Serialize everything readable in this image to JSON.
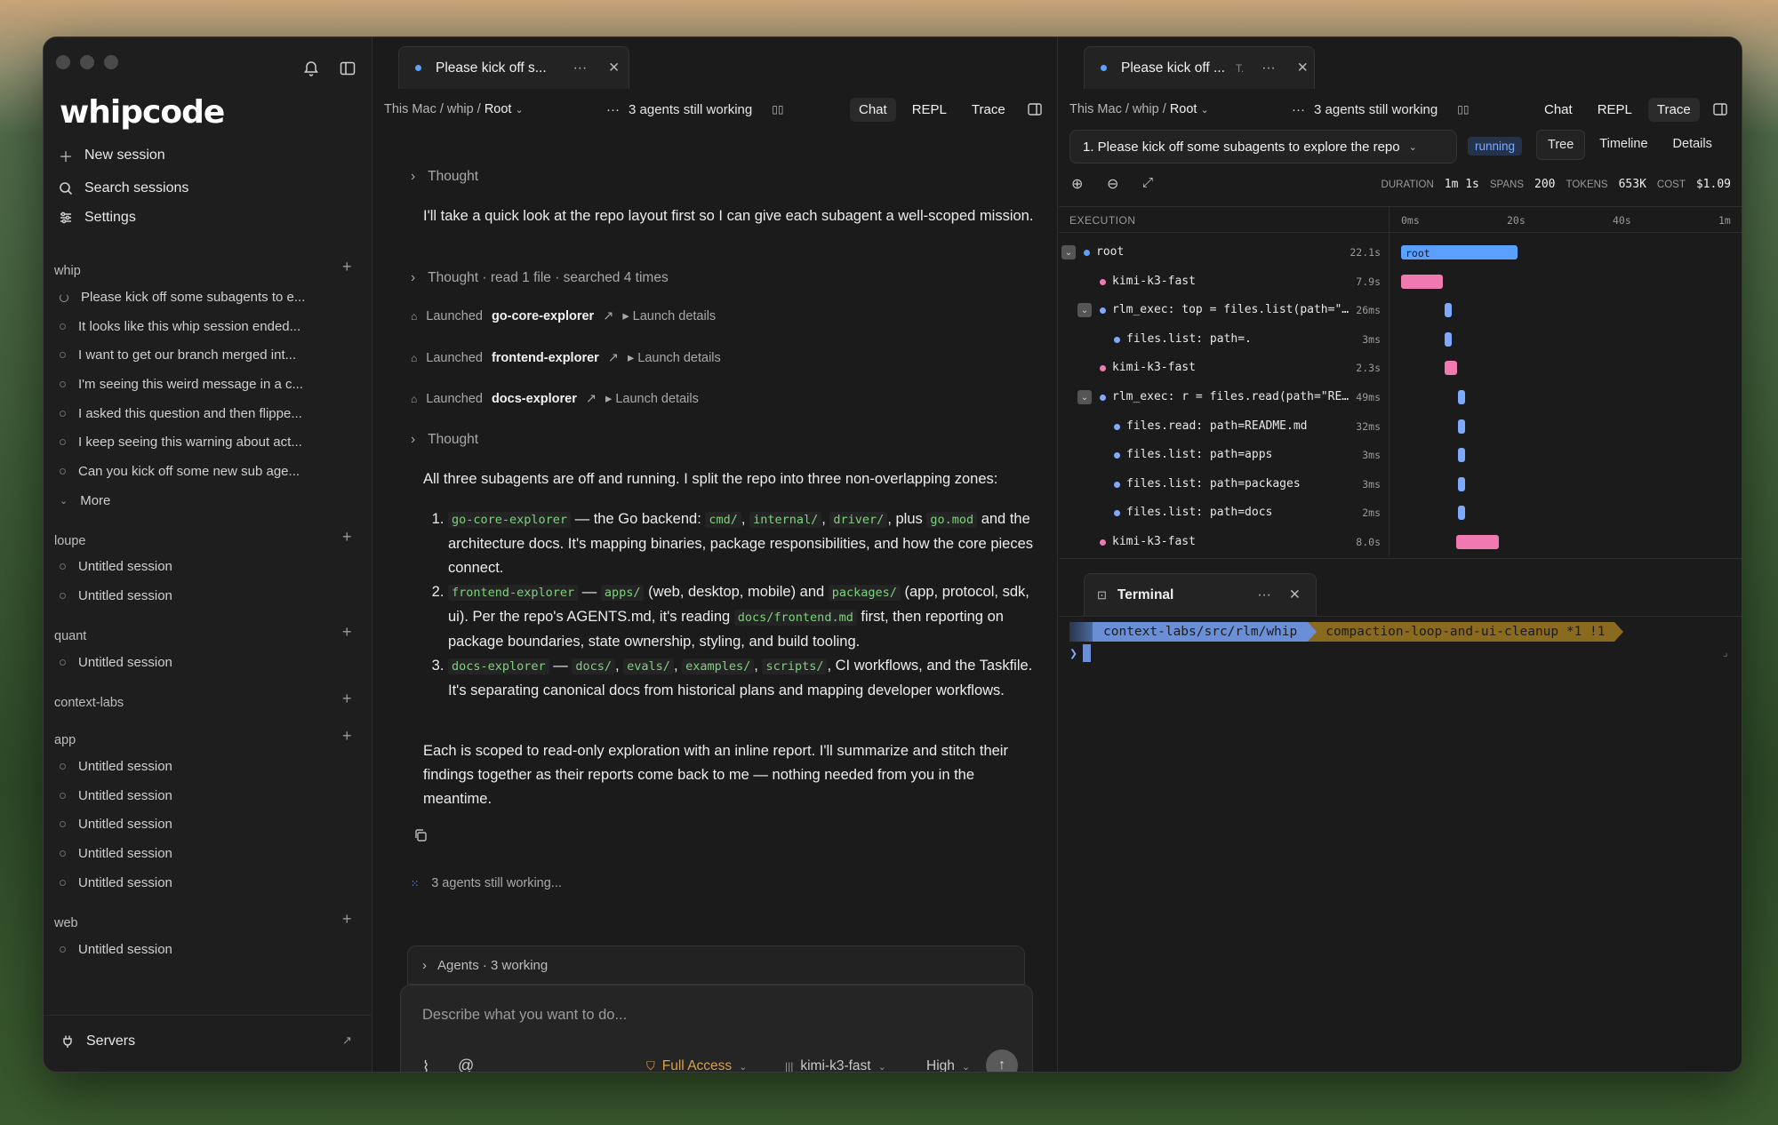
{
  "sidebar": {
    "logo": "whipcode",
    "nav": {
      "new_session": "New session",
      "search": "Search sessions",
      "settings": "Settings"
    },
    "groups": [
      {
        "name": "whip",
        "sessions": [
          "Please kick off some subagents to e...",
          "It looks like this whip session ended...",
          "I want to get our branch merged int...",
          "I'm seeing this weird message in a c...",
          "I asked this question and then flippe...",
          "I keep seeing this warning about act...",
          "Can you kick off some new sub age..."
        ],
        "more": "More"
      },
      {
        "name": "loupe",
        "sessions": [
          "Untitled session",
          "Untitled session"
        ]
      },
      {
        "name": "quant",
        "sessions": [
          "Untitled session"
        ]
      },
      {
        "name": "context-labs",
        "sessions": []
      },
      {
        "name": "app",
        "sessions": [
          "Untitled session",
          "Untitled session",
          "Untitled session",
          "Untitled session",
          "Untitled session"
        ]
      },
      {
        "name": "web",
        "sessions": [
          "Untitled session"
        ]
      }
    ],
    "servers": "Servers"
  },
  "chat": {
    "tab_title": "Please kick off s...",
    "breadcrumb_prefix": "This Mac / whip /",
    "breadcrumb_root": "Root",
    "agents_status": "3 agents still working",
    "modes": [
      "Chat",
      "REPL",
      "Trace"
    ],
    "thought1": "Thought",
    "msg1": "I'll take a quick look at the repo layout first so I can give each subagent a well-scoped mission.",
    "thought2": "Thought · read 1 file · searched 4 times",
    "launched_word": "Launched",
    "launch_details": "Launch details",
    "agents": [
      "go-core-explorer",
      "frontend-explorer",
      "docs-explorer"
    ],
    "thought3": "Thought",
    "msg2": "All three subagents are off and running. I split the repo into three non-overlapping zones:",
    "item1": {
      "name": "go-core-explorer",
      "t1": " — the Go backend: ",
      "c1": "cmd/",
      "c2": "internal/",
      "c3": "driver/",
      "t2": ", plus ",
      "c4": "go.mod",
      "t3": " and the architecture docs. It's mapping binaries, package responsibilities, and how the core pieces connect."
    },
    "item2": {
      "name": "frontend-explorer",
      "t1": " — ",
      "c1": "apps/",
      "t2": " (web, desktop, mobile) and ",
      "c2": "packages/",
      "t3": " (app, protocol, sdk, ui). Per the repo's AGENTS.md, it's reading ",
      "c3": "docs/frontend.md",
      "t4": " first, then reporting on package boundaries, state ownership, styling, and build tooling."
    },
    "item3": {
      "name": "docs-explorer",
      "t1": " — ",
      "c1": "docs/",
      "c2": "evals/",
      "c3": "examples/",
      "c4": "scripts/",
      "t2": ", CI workflows, and the Taskfile. It's separating canonical docs from historical plans and mapping developer workflows."
    },
    "msg3": "Each is scoped to read-only exploration with an inline report. I'll summarize and stitch their findings together as their reports come back to me — nothing needed from you in the meantime.",
    "working": "3 agents still working...",
    "agents_bar": "Agents · 3 working",
    "placeholder": "Describe what you want to do...",
    "access": "Full Access",
    "model": "kimi-k3-fast",
    "effort": "High"
  },
  "trace": {
    "tab_title": "Please kick off ...",
    "tab_suffix": "T.",
    "breadcrumb_prefix": "This Mac / whip /",
    "breadcrumb_root": "Root",
    "agents_status": "3 agents still working",
    "modes": [
      "Chat",
      "REPL",
      "Trace"
    ],
    "run_select": "1. Please kick off some subagents to explore the repo",
    "run_status": "running",
    "views": [
      "Tree",
      "Timeline",
      "Details"
    ],
    "stats": {
      "duration_label": "DURATION",
      "duration": "1m 1s",
      "spans_label": "SPANS",
      "spans": "200",
      "tokens_label": "TOKENS",
      "tokens": "653K",
      "cost_label": "COST",
      "cost": "$1.09"
    },
    "execution_label": "EXECUTION",
    "ticks": [
      "0ms",
      "20s",
      "40s",
      "1m"
    ],
    "spans": [
      {
        "name": "root",
        "duration": "22.1s",
        "color": "#5aa0ff",
        "bar_label": "root",
        "start_s": 0,
        "len_s": 22.1
      },
      {
        "name": "kimi-k3-fast",
        "duration": "7.9s",
        "color": "#f07ab0",
        "start_s": 0,
        "len_s": 7.9
      },
      {
        "name": "rlm_exec: top = files.list(path=\"…",
        "duration": "26ms",
        "color": "#7fa8ff",
        "start_s": 8.2,
        "len_s": 0.026
      },
      {
        "name": "files.list: path=.",
        "duration": "3ms",
        "color": "#7fa8ff",
        "start_s": 8.2,
        "len_s": 0.003
      },
      {
        "name": "kimi-k3-fast",
        "duration": "2.3s",
        "color": "#f07ab0",
        "start_s": 8.3,
        "len_s": 2.3
      },
      {
        "name": "rlm_exec: r = files.read(path=\"RE…",
        "duration": "49ms",
        "color": "#7fa8ff",
        "start_s": 10.7,
        "len_s": 0.049
      },
      {
        "name": "files.read: path=README.md",
        "duration": "32ms",
        "color": "#7fa8ff",
        "start_s": 10.7,
        "len_s": 0.032
      },
      {
        "name": "files.list: path=apps",
        "duration": "3ms",
        "color": "#7fa8ff",
        "start_s": 10.7,
        "len_s": 0.003
      },
      {
        "name": "files.list: path=packages",
        "duration": "3ms",
        "color": "#7fa8ff",
        "start_s": 10.7,
        "len_s": 0.003
      },
      {
        "name": "files.list: path=docs",
        "duration": "2ms",
        "color": "#7fa8ff",
        "start_s": 10.7,
        "len_s": 0.002
      },
      {
        "name": "kimi-k3-fast",
        "duration": "8.0s",
        "color": "#f07ab0",
        "start_s": 10.5,
        "len_s": 8.0
      }
    ]
  },
  "terminal": {
    "title": "Terminal",
    "path": "context-labs/src/rlm/whip",
    "branch": "compaction-loop-and-ui-cleanup *1 !1",
    "prompt": "❯"
  }
}
